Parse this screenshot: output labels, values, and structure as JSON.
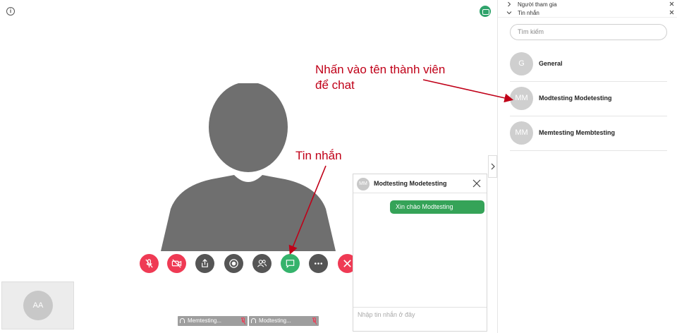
{
  "sidebar": {
    "sections": [
      {
        "label": "Người tham gia",
        "chevron": "chevron-right-icon"
      },
      {
        "label": "Tin nhắn",
        "chevron": "chevron-down-icon"
      }
    ],
    "search_placeholder": "Tìm kiếm",
    "contacts": [
      {
        "initials": "G",
        "name": "General"
      },
      {
        "initials": "MM",
        "name": "Modtesting Modetesting"
      },
      {
        "initials": "MM",
        "name": "Memtesting Membtesting"
      }
    ]
  },
  "annotations": {
    "member_chat": "Nhấn vào tên thành viên để chat",
    "chat_button": "Tin nhắn"
  },
  "chat": {
    "avatar_initials": "MM",
    "title": "Modtesting Modetesting",
    "messages": [
      "Xin chào Modtesting"
    ],
    "input_placeholder": "Nhập tin nhắn ở đây"
  },
  "self_view": {
    "initials": "AA"
  },
  "participant_tiles": [
    {
      "label": "Memtesting..."
    },
    {
      "label": "Modtesting..."
    }
  ],
  "controls": [
    {
      "name": "mic-muted-icon",
      "color": "#ef3a54"
    },
    {
      "name": "camera-off-icon",
      "color": "#ef3a54"
    },
    {
      "name": "share-screen-icon",
      "color": "#555555"
    },
    {
      "name": "record-icon",
      "color": "#555555"
    },
    {
      "name": "participants-icon",
      "color": "#555555"
    },
    {
      "name": "chat-icon",
      "color": "#35b36c"
    },
    {
      "name": "more-icon",
      "color": "#555555"
    },
    {
      "name": "hang-up-icon",
      "color": "#ef3a54"
    }
  ],
  "colors": {
    "accent_green": "#35a358",
    "danger_red": "#ef3a54",
    "annotation_red": "#c00018"
  }
}
